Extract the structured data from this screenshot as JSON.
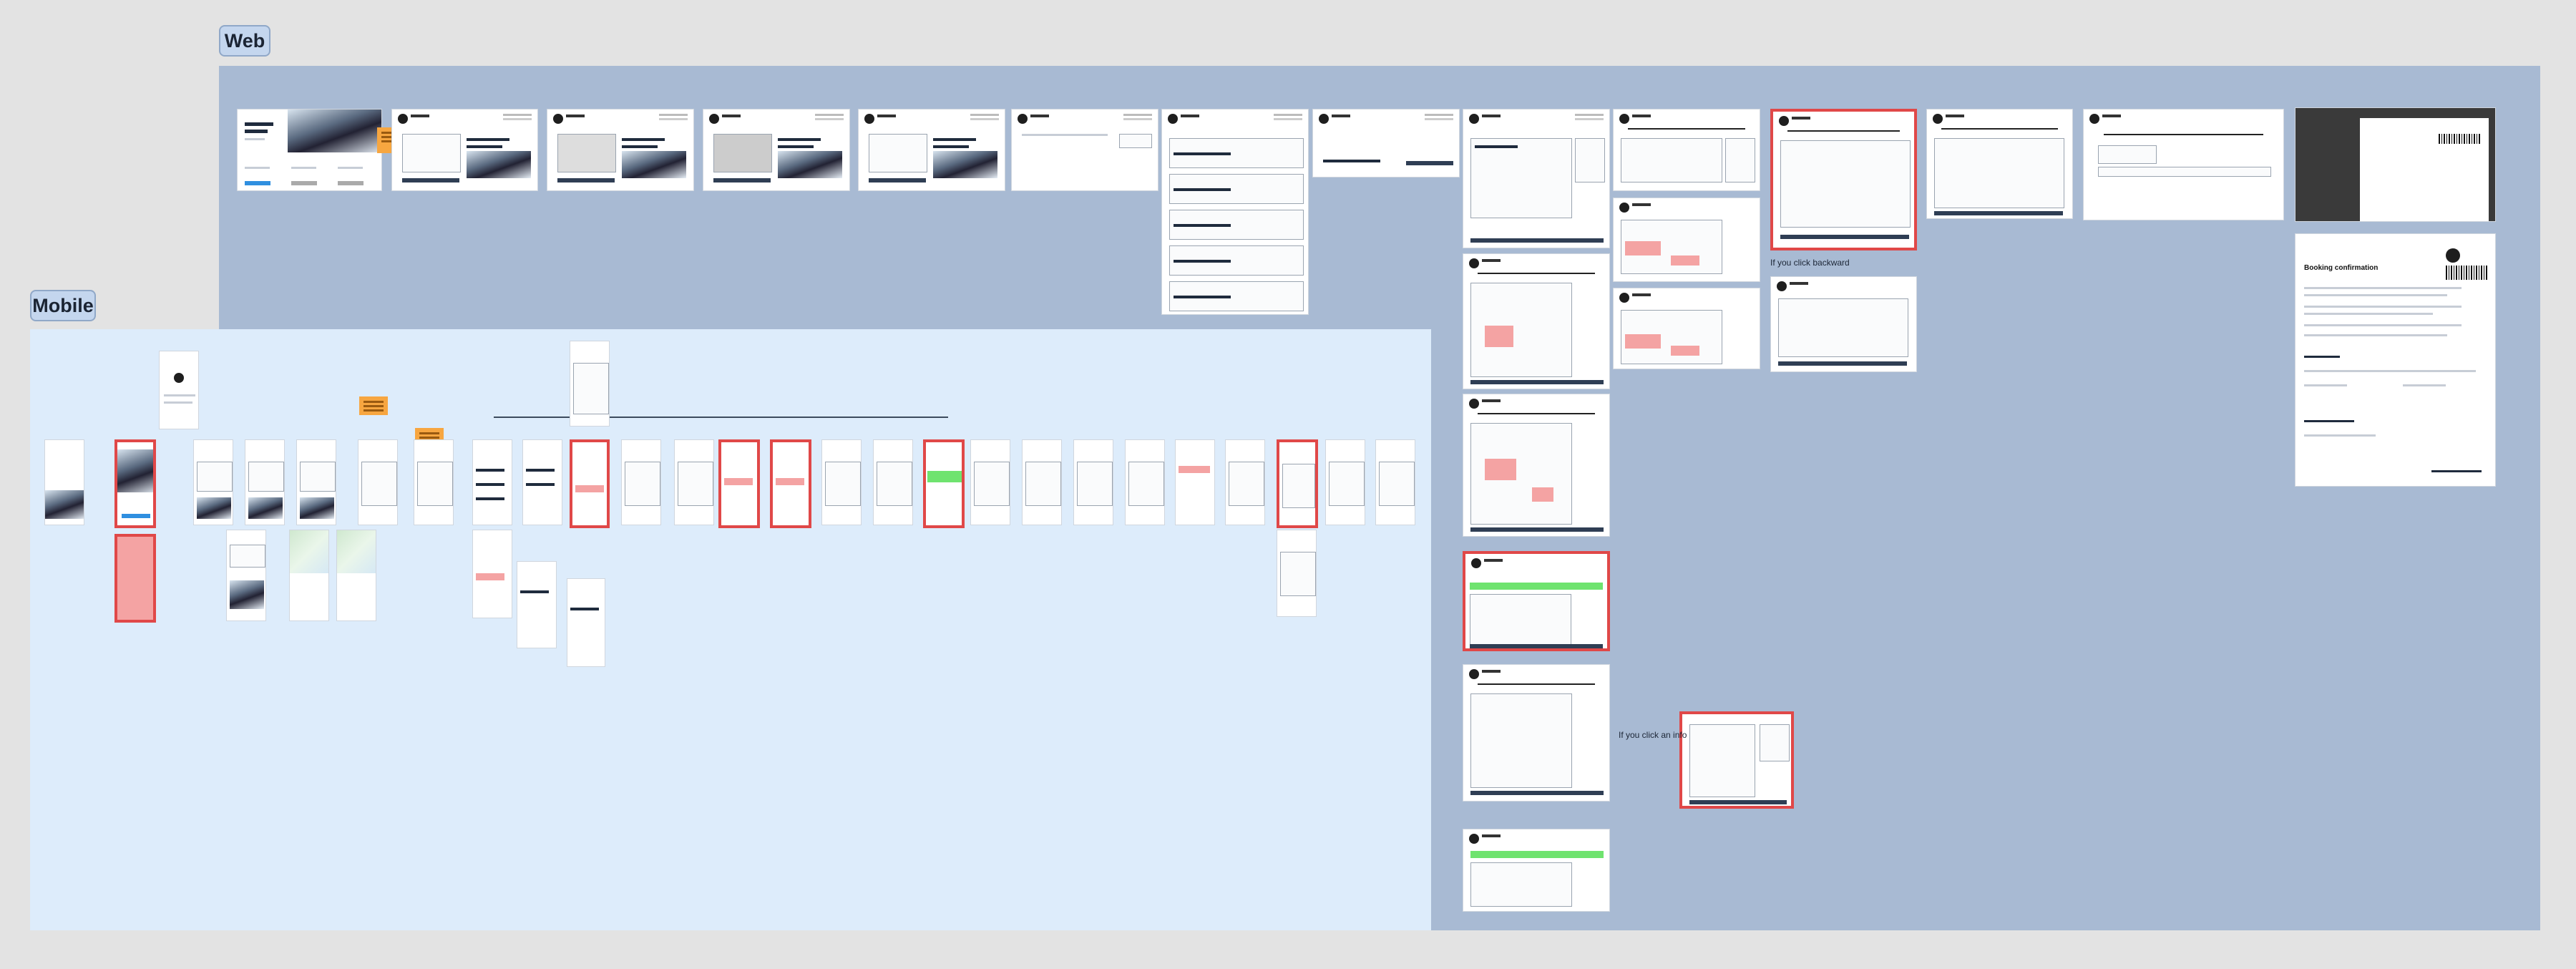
{
  "canvas": {
    "sections": {
      "web": {
        "label": "Web"
      },
      "mobile": {
        "label": "Mobile"
      }
    },
    "annotations": {
      "click_backward": "If you click backward",
      "click_info": "If you click an info"
    },
    "confirmation_doc": {
      "title": "Booking confirmation"
    }
  },
  "colors": {
    "web_region": "#a8bad3",
    "mobile_region": "#ddecfb",
    "highlight_border": "#e04848",
    "sticky_note": "#f7a640",
    "success_banner": "#6fe36f",
    "error_fill": "#f4a3a3",
    "canvas_background": "#e3e3e3"
  }
}
